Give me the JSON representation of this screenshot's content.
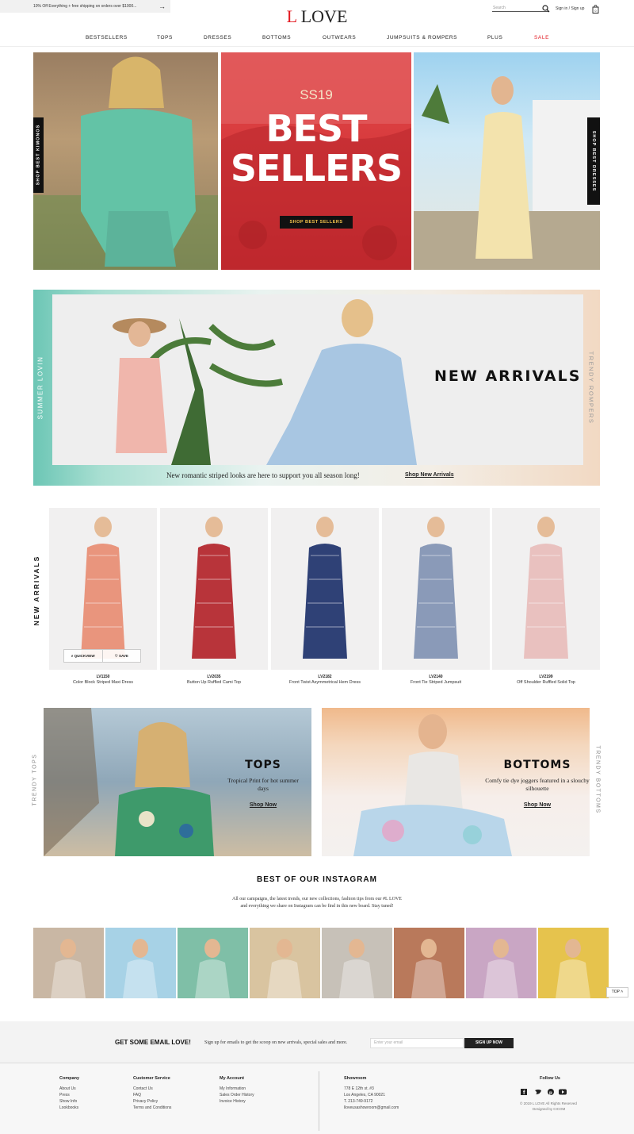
{
  "promo": {
    "text": "10% Off Everything + free shipping on orders over $1000...",
    "arrow": "→"
  },
  "header": {
    "logo_l": "L",
    "logo_word": "LOVE",
    "search_placeholder": "Search",
    "sign_in": "Sign in / Sign up",
    "bag_count": "0"
  },
  "nav": [
    "BESTSELLERS",
    "TOPS",
    "DRESSES",
    "BOTTOMS",
    "OUTWEARS",
    "JUMPSUITS & ROMPERS",
    "PLUS",
    "SALE"
  ],
  "hero": {
    "left_tab": "SHOP BEST KIMONOS",
    "center_kicker": "SS19",
    "center_title_1": "BEST",
    "center_title_2": "SELLERS",
    "center_button": "SHOP BEST SELLERS",
    "right_tab": "SHOP BEST DRESSES"
  },
  "arrivals_banner": {
    "side_left": "SUMMER LOVIN",
    "side_right": "TRENDY ROMPERS",
    "title": "NEW ARRIVALS",
    "caption": "New romantic striped looks are here to support you all season long!",
    "link": "Shop New Arrivals"
  },
  "carousel": {
    "label": "NEW ARRIVALS",
    "quickview": "QUICKVIEW",
    "save": "SAVE",
    "products": [
      {
        "code": "LV1150",
        "name": "Color Block Striped Maxi Dress",
        "color": "#e9957d"
      },
      {
        "code": "LV2035",
        "name": "Button Up Ruffled Cami Top",
        "color": "#b8343a"
      },
      {
        "code": "LV2182",
        "name": "Front Twist Asymmetrical Hem Dress",
        "color": "#2f4176"
      },
      {
        "code": "LV2140",
        "name": "Front Tie Striped Jumpsuit",
        "color": "#8a9ab8"
      },
      {
        "code": "LV2199",
        "name": "Off Shoulder Ruffled Solid Top",
        "color": "#e9c1bf"
      }
    ]
  },
  "promos": {
    "left_side": "TRENDY TOPS",
    "right_side": "TRENDY BOTTOMS",
    "tops_title": "TOPS",
    "tops_text": "Tropical Print for hot summer days",
    "tops_link": "Shop Now",
    "bottoms_title": "BOTTOMS",
    "bottoms_text": "Comfy tie dye joggers featured in a slouchy silhouette",
    "bottoms_link": "Shop Now"
  },
  "instagram": {
    "title": "BEST OF OUR INSTAGRAM",
    "text_1": "All our campaigns, the latest trends, our new collections, fashion tips from our #L LOVE",
    "text_2": "and everything we share on Instagram can be find in this new board. Stay tuned!",
    "tiles": [
      "#c9b7a4",
      "#a7d2e6",
      "#7fbfa7",
      "#d9c4a0",
      "#c7c1b8",
      "#b9795b",
      "#c9a6c4",
      "#e6c34d"
    ],
    "top_button": "TOP"
  },
  "newsletter": {
    "title": "GET SOME EMAIL LOVE!",
    "text": "Sign up for emails to get the scoop on new arrivals, special sales and more.",
    "placeholder": "Enter your email",
    "button": "SIGN UP NOW"
  },
  "footer": {
    "company": {
      "title": "Company",
      "links": [
        "About Us",
        "Press",
        "Show Info",
        "Lookbooks"
      ]
    },
    "service": {
      "title": "Customer Service",
      "links": [
        "Contact Us",
        "FAQ",
        "Privacy Policy",
        "Terms and Conditions"
      ]
    },
    "account": {
      "title": "My Account",
      "links": [
        "My Information",
        "Sales Order History",
        "Invoice History"
      ]
    },
    "showroom": {
      "title": "Showroom",
      "lines": [
        "778 E 12th st. #3",
        "Los Angeles, CA 90021",
        "T. 213-749-9172",
        "lloveusashowroom@gmail.com"
      ]
    },
    "follow": {
      "title": "Follow Us",
      "copyright": "© 2019 L LOVE All Rights Reserved",
      "designed": "Designed by CICOM"
    }
  }
}
